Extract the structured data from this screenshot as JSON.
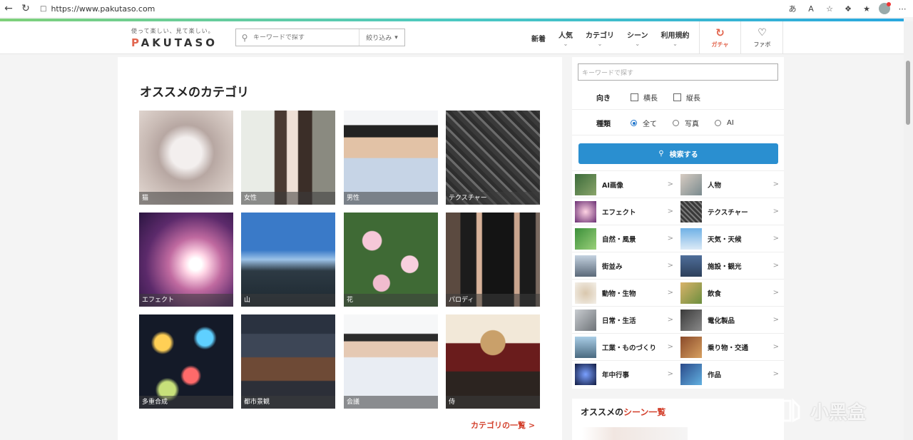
{
  "browser": {
    "url": "https://www.pakutaso.com",
    "icons": [
      "back-icon",
      "refresh-icon",
      "lock-icon",
      "read-aloud-icon",
      "text-size-icon",
      "favorite-star-icon",
      "extensions-icon",
      "favorites-icon",
      "profile-icon",
      "more-icon"
    ]
  },
  "header": {
    "logo_tagline": "使って楽しい、見て楽しい。",
    "logo_p": "P",
    "logo_rest": "AKUTASO",
    "search_placeholder": "キーワードで探す",
    "filter_label": "絞り込み",
    "nav": [
      "新着",
      "人気",
      "カテゴリ",
      "シーン",
      "利用規約"
    ],
    "gacha_label": "ガチャ",
    "fav_label": "ファボ"
  },
  "main": {
    "title": "オススメのカテゴリ",
    "tiles": [
      {
        "label": "猫"
      },
      {
        "label": "女性"
      },
      {
        "label": "男性"
      },
      {
        "label": "テクスチャー"
      },
      {
        "label": "エフェクト"
      },
      {
        "label": "山"
      },
      {
        "label": "花"
      },
      {
        "label": "パロディ"
      },
      {
        "label": "多重合成"
      },
      {
        "label": "都市景観"
      },
      {
        "label": "会議"
      },
      {
        "label": "侍"
      }
    ],
    "more_link": "カテゴリの一覧 >"
  },
  "sidebar": {
    "search_placeholder": "キーワードで探す",
    "orientation_label": "向き",
    "orientation_options": [
      "横長",
      "縦長"
    ],
    "type_label": "種類",
    "type_options": [
      "全て",
      "写真",
      "AI"
    ],
    "type_selected": "全て",
    "search_button": "検索する",
    "categories": [
      [
        "AI画像",
        "人物"
      ],
      [
        "エフェクト",
        "テクスチャー"
      ],
      [
        "自然・風景",
        "天気・天候"
      ],
      [
        "街並み",
        "施設・観光"
      ],
      [
        "動物・生物",
        "飲食"
      ],
      [
        "日常・生活",
        "電化製品"
      ],
      [
        "工業・ものづくり",
        "乗り物・交通"
      ],
      [
        "年中行事",
        "作品"
      ]
    ]
  },
  "scene": {
    "title_prefix": "オススメの",
    "title_accent": "シーン一覧"
  },
  "watermark": {
    "text": "小黑盒"
  }
}
